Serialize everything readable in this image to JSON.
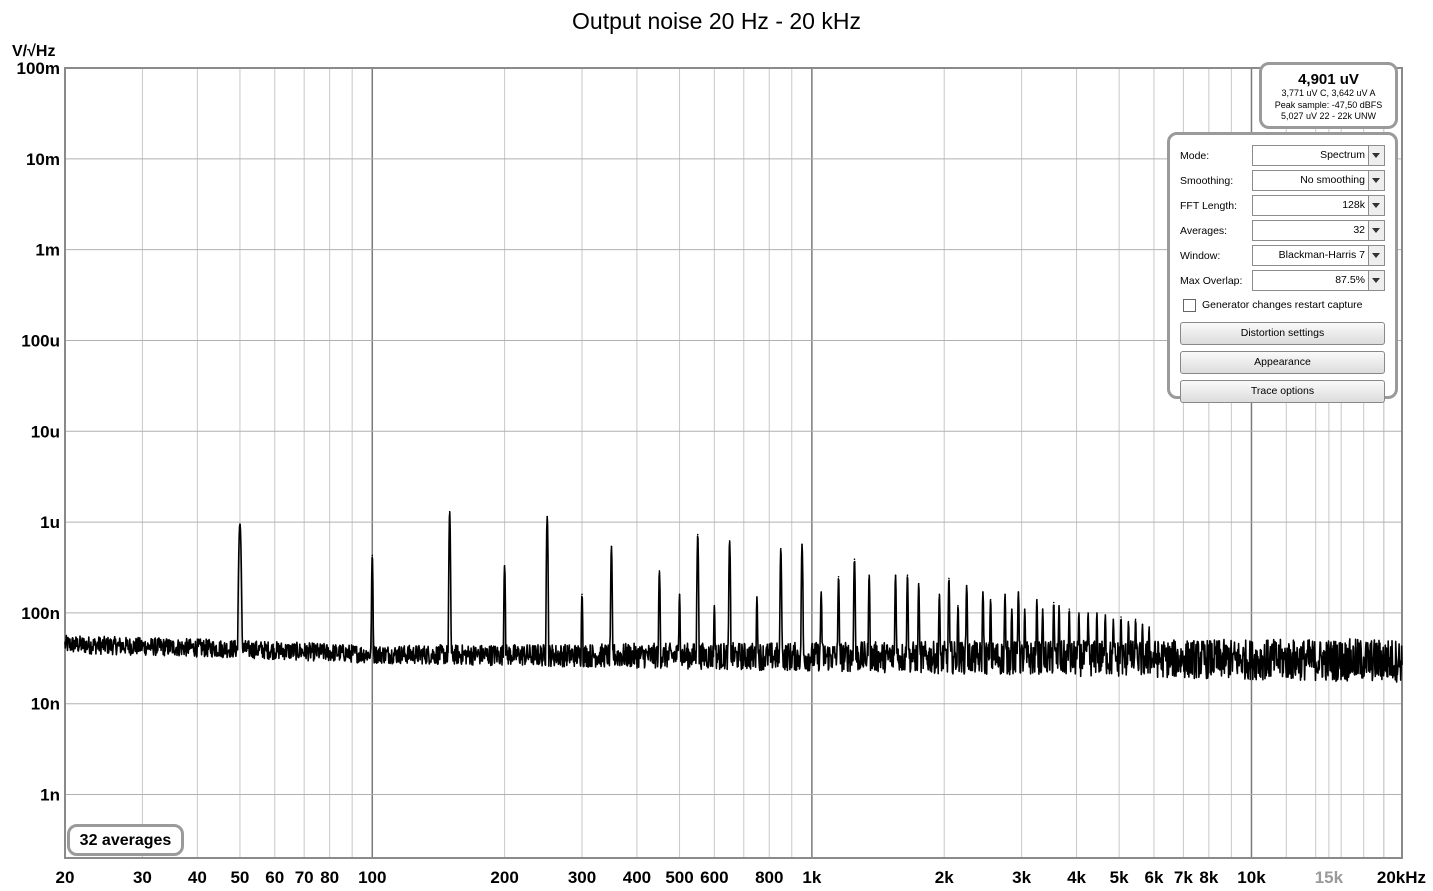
{
  "chart_data": {
    "type": "line",
    "title": "Output noise 20 Hz - 20 kHz",
    "ylabel": "V/√Hz",
    "xlabel": "",
    "x_scale": "log",
    "y_scale": "log",
    "xlim": [
      20,
      22000
    ],
    "ylim": [
      2e-10,
      0.1
    ],
    "y_ticks": [
      {
        "value": 0.1,
        "label": "100m"
      },
      {
        "value": 0.01,
        "label": "10m"
      },
      {
        "value": 0.001,
        "label": "1m"
      },
      {
        "value": 0.0001,
        "label": "100u"
      },
      {
        "value": 1e-05,
        "label": "10u"
      },
      {
        "value": 1e-06,
        "label": "1u"
      },
      {
        "value": 1e-07,
        "label": "100n"
      },
      {
        "value": 1e-08,
        "label": "10n"
      },
      {
        "value": 1e-09,
        "label": "1n"
      }
    ],
    "x_ticks": [
      {
        "value": 20,
        "label": "20"
      },
      {
        "value": 30,
        "label": "30"
      },
      {
        "value": 40,
        "label": "40"
      },
      {
        "value": 50,
        "label": "50"
      },
      {
        "value": 60,
        "label": "60"
      },
      {
        "value": 70,
        "label": "70"
      },
      {
        "value": 80,
        "label": "80"
      },
      {
        "value": 100,
        "label": "100"
      },
      {
        "value": 200,
        "label": "200"
      },
      {
        "value": 300,
        "label": "300"
      },
      {
        "value": 400,
        "label": "400"
      },
      {
        "value": 500,
        "label": "500"
      },
      {
        "value": 600,
        "label": "600"
      },
      {
        "value": 800,
        "label": "800"
      },
      {
        "value": 1000,
        "label": "1k"
      },
      {
        "value": 2000,
        "label": "2k"
      },
      {
        "value": 3000,
        "label": "3k"
      },
      {
        "value": 4000,
        "label": "4k"
      },
      {
        "value": 5000,
        "label": "5k"
      },
      {
        "value": 6000,
        "label": "6k"
      },
      {
        "value": 7000,
        "label": "7k"
      },
      {
        "value": 8000,
        "label": "8k"
      },
      {
        "value": 10000,
        "label": "10k"
      },
      {
        "value": 15000,
        "label": "15k",
        "muted": true
      },
      {
        "value": 20000,
        "label": "20kHz"
      }
    ],
    "grid": true,
    "series": [
      {
        "color": "#000000",
        "noise_floor": [
          [
            20,
            4.5e-08
          ],
          [
            50,
            4e-08
          ],
          [
            100,
            3.5e-08
          ],
          [
            1000,
            3.3e-08
          ],
          [
            20000,
            3e-08
          ]
        ],
        "peaks": [
          [
            50,
            9.5e-07
          ],
          [
            100,
            4.3e-07
          ],
          [
            150,
            1.3e-06
          ],
          [
            200,
            3.3e-07
          ],
          [
            250,
            1.15e-06
          ],
          [
            300,
            1.6e-07
          ],
          [
            350,
            5.4e-07
          ],
          [
            450,
            2.9e-07
          ],
          [
            500,
            1.6e-07
          ],
          [
            550,
            7.3e-07
          ],
          [
            600,
            1.2e-07
          ],
          [
            650,
            6.2e-07
          ],
          [
            750,
            1.5e-07
          ],
          [
            850,
            5.1e-07
          ],
          [
            950,
            5.7e-07
          ],
          [
            1050,
            1.7e-07
          ],
          [
            1150,
            2.5e-07
          ],
          [
            1250,
            3.9e-07
          ],
          [
            1350,
            2.6e-07
          ],
          [
            1550,
            2.6e-07
          ],
          [
            1650,
            2.6e-07
          ],
          [
            1750,
            2.1e-07
          ],
          [
            1950,
            1.6e-07
          ],
          [
            2050,
            2.4e-07
          ],
          [
            2150,
            1.2e-07
          ],
          [
            2250,
            2e-07
          ],
          [
            2450,
            1.7e-07
          ],
          [
            2550,
            1.4e-07
          ],
          [
            2750,
            1.6e-07
          ],
          [
            2850,
            1.1e-07
          ],
          [
            2950,
            1.7e-07
          ],
          [
            3050,
            1.1e-07
          ],
          [
            3250,
            1.4e-07
          ],
          [
            3350,
            1.1e-07
          ],
          [
            3550,
            1.3e-07
          ],
          [
            3650,
            1.2e-07
          ],
          [
            3850,
            1.1e-07
          ],
          [
            4050,
            1e-07
          ],
          [
            4250,
            1e-07
          ],
          [
            4450,
            1e-07
          ],
          [
            4650,
            9.5e-08
          ],
          [
            4850,
            8.5e-08
          ],
          [
            5050,
            9e-08
          ],
          [
            5250,
            8e-08
          ],
          [
            5450,
            8.5e-08
          ],
          [
            5650,
            7.5e-08
          ],
          [
            5850,
            7e-08
          ]
        ]
      }
    ]
  },
  "readout": {
    "main": "4,901 uV",
    "line1": "3,771 uV C, 3,642 uV A",
    "line2": "Peak sample: -47,50 dBFS",
    "line3": "5,027 uV 22 - 22k UNW"
  },
  "settings": {
    "mode_label": "Mode:",
    "mode_value": "Spectrum",
    "smoothing_label": "Smoothing:",
    "smoothing_value": "No  smoothing",
    "fft_label": "FFT Length:",
    "fft_value": "128k",
    "averages_label": "Averages:",
    "averages_value": "32",
    "window_label": "Window:",
    "window_value": "Blackman-Harris 7",
    "overlap_label": "Max Overlap:",
    "overlap_value": "87.5%",
    "generator_label": "Generator changes restart capture",
    "distortion_button": "Distortion settings",
    "appearance_button": "Appearance",
    "trace_button": "Trace options"
  },
  "badge": {
    "averages": "32 averages"
  }
}
